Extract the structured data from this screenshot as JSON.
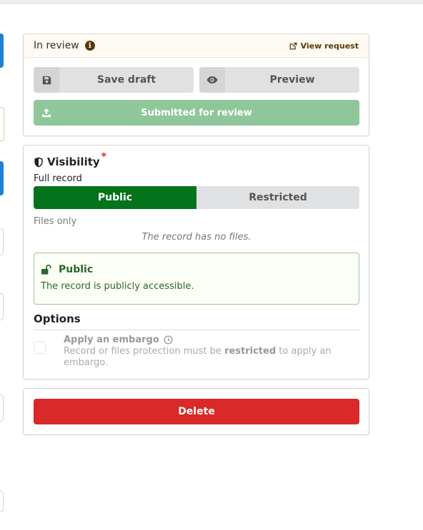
{
  "status": {
    "label": "In review",
    "view_request": "View request",
    "save_draft": "Save draft",
    "preview": "Preview",
    "submit": "Submitted for review"
  },
  "visibility": {
    "title": "Visibility",
    "required_marker": "*",
    "full_record_label": "Full record",
    "public_option": "Public",
    "restricted_option": "Restricted",
    "files_only_label": "Files only",
    "no_files_text": "The record has no files.",
    "message_title": "Public",
    "message_text": "The record is publicly accessible."
  },
  "options": {
    "title": "Options",
    "embargo_label": "Apply an embargo",
    "embargo_desc_prefix": "Record or files protection must be",
    "embargo_desc_bold": "restricted",
    "embargo_desc_suffix": "to apply an embargo."
  },
  "actions": {
    "delete": "Delete"
  },
  "colors": {
    "public_green": "#04731b",
    "submit_green": "#8fc79a",
    "delete_red": "#db2828",
    "status_brown": "#573a08"
  }
}
